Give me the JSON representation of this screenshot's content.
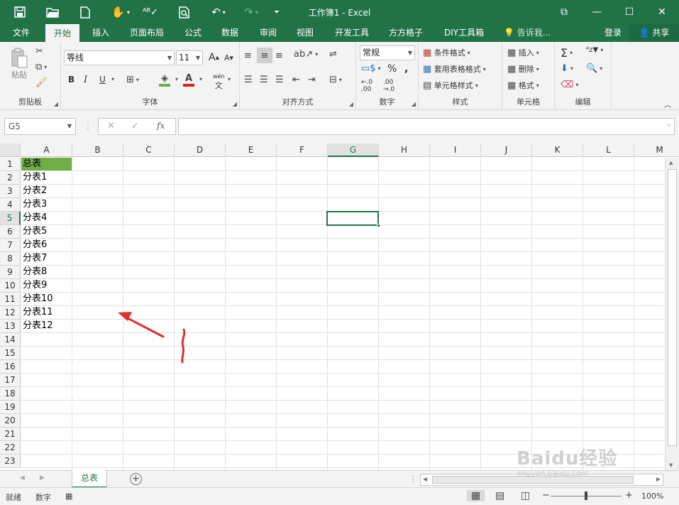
{
  "window": {
    "title": "工作簿1 - Excel",
    "controls": {
      "restore": "⧉",
      "minimize": "—",
      "maximize": "☐",
      "close": "✕"
    }
  },
  "quick_access": [
    "save-icon",
    "open-folder-icon",
    "new-file-icon",
    "touch-mode-icon",
    "spelling-icon",
    "print-preview-icon",
    "undo-icon",
    "redo-icon",
    "customize-qat-icon"
  ],
  "tabs": {
    "items": [
      "文件",
      "开始",
      "插入",
      "页面布局",
      "公式",
      "数据",
      "审阅",
      "视图",
      "开发工具",
      "方方格子",
      "DIY工具箱"
    ],
    "active": "开始",
    "tell_me": "告诉我...",
    "signin": "登录",
    "share": "共享"
  },
  "ribbon": {
    "clipboard": {
      "paste": "粘贴",
      "label": "剪贴板"
    },
    "font": {
      "name": "等线",
      "size": "11",
      "label": "字体",
      "bold": "B",
      "italic": "I",
      "underline": "U",
      "grow": "A",
      "shrink": "A",
      "phonetic": "wén",
      "font_color": "#e02020",
      "fill_color": "#ffd400"
    },
    "alignment": {
      "label": "对齐方式"
    },
    "number": {
      "format": "常规",
      "percent": "%",
      "comma": ",",
      "label": "数字"
    },
    "styles": {
      "conditional": "条件格式",
      "table": "套用表格格式",
      "cell": "单元格样式",
      "label": "样式"
    },
    "cells": {
      "insert": "插入",
      "delete": "删除",
      "format": "格式",
      "label": "单元格"
    },
    "editing": {
      "label": "编辑"
    }
  },
  "formula_bar": {
    "name_box": "G5",
    "fx": "fx",
    "formula": ""
  },
  "grid": {
    "columns": [
      "A",
      "B",
      "C",
      "D",
      "E",
      "F",
      "G",
      "H",
      "I",
      "J",
      "K",
      "L",
      "M"
    ],
    "rows": [
      "1",
      "2",
      "3",
      "4",
      "5",
      "6",
      "7",
      "8",
      "9",
      "10",
      "11",
      "12",
      "13",
      "14",
      "15",
      "16",
      "17",
      "18",
      "19",
      "20",
      "21",
      "22",
      "23"
    ],
    "column_a": [
      "总表",
      "分表1",
      "分表2",
      "分表3",
      "分表4",
      "分表5",
      "分表6",
      "分表7",
      "分表8",
      "分表9",
      "分表10",
      "分表11",
      "分表12"
    ],
    "selected_cell": "G5",
    "header_fill": "#70ad47"
  },
  "sheet_tabs": {
    "items": [
      "总表"
    ],
    "active": "总表",
    "add": "+"
  },
  "status": {
    "ready": "就绪",
    "mode": "数字",
    "zoom": "100%",
    "zoom_out": "−",
    "zoom_in": "+"
  },
  "watermark": {
    "text": "Baidu经验",
    "url": "jingyan.baidu.com"
  },
  "colors": {
    "excel_green": "#217346",
    "annotation_red": "#e03030"
  }
}
